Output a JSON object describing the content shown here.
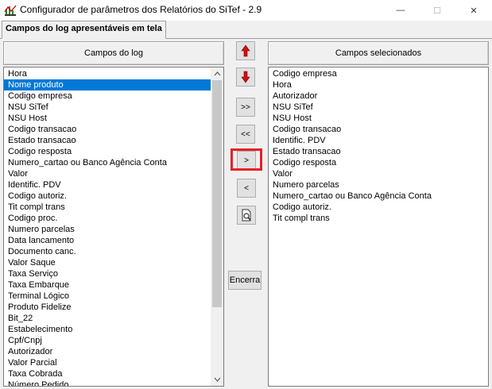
{
  "window": {
    "title": "Configurador de parâmetros dos Relatórios do SiTef - 2.9",
    "min_glyph": "—",
    "max_glyph": "☐",
    "close_glyph": "✕"
  },
  "tab": {
    "label": "Campos do log apresentáveis em tela"
  },
  "left_panel": {
    "header": "Campos do log",
    "items": [
      "Hora",
      "Nome produto",
      "Codigo empresa",
      "NSU SiTef",
      "NSU Host",
      "Codigo transacao",
      "Estado transacao",
      "Codigo resposta",
      "Numero_cartao ou Banco Agência Conta",
      "Valor",
      "Identific. PDV",
      "Codigo autoriz.",
      "Tit compl trans",
      "Codigo proc.",
      "Numero parcelas",
      "Data lancamento",
      "Documento canc.",
      "Valor Saque",
      "Taxa Serviço",
      "Taxa Embarque",
      "Terminal Lógico",
      "Produto Fidelize",
      "Bit_22",
      "Estabelecimento",
      "Cpf/Cnpj",
      "Autorizador",
      "Valor Parcial",
      "Taxa Cobrada",
      "Número Pedido"
    ],
    "selected_index": 1
  },
  "right_panel": {
    "header": "Campos selecionados",
    "items": [
      "Codigo empresa",
      "Hora",
      "Autorizador",
      "NSU SiTef",
      "NSU Host",
      "Codigo transacao",
      "Identific. PDV",
      "Estado transacao",
      "Codigo resposta",
      "Valor",
      "Numero parcelas",
      "Numero_cartao ou Banco Agência Conta",
      "Codigo autoriz.",
      "Tit compl trans"
    ]
  },
  "buttons": {
    "move_all_right": ">>",
    "move_all_left": "<<",
    "move_right": ">",
    "move_left": "<",
    "close": "Encerra"
  },
  "colors": {
    "selection": "#0078d7",
    "highlight": "#e8202a",
    "arrow_red": "#d01010"
  }
}
